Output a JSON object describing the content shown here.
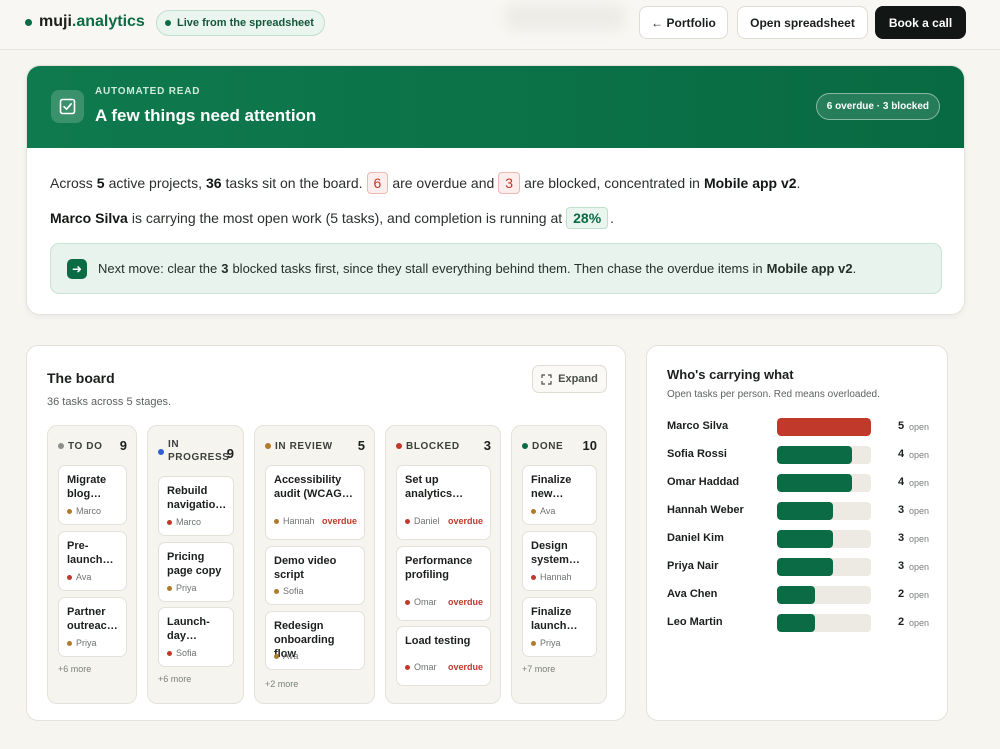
{
  "topbar": {
    "brand_a": "muji",
    "brand_b": ".analytics",
    "live_label": "Live from the spreadsheet",
    "portfolio_label": "← Portfolio",
    "spreadsheet_label": "Open spreadsheet",
    "book_label": "Book a call"
  },
  "hero": {
    "kicker": "AUTOMATED READ",
    "title": "A few things need attention",
    "badge": "6 overdue · 3 blocked",
    "l1_a": "Across",
    "l1_projects": "5",
    "l1_b": "active projects,",
    "l1_tasks": "36",
    "l1_c": "tasks sit on the board.",
    "l1_overdue": "6",
    "l1_d": "are overdue and",
    "l1_blocked": "3",
    "l1_e": "are blocked, concentrated in",
    "l1_project": "Mobile app v2",
    "l1_end": ".",
    "l2_name": "Marco Silva",
    "l2_a": "is carrying the most open work (5 tasks), and completion is running at",
    "l2_pct": "28%",
    "l2_end": ".",
    "next_a": "Next move: clear the",
    "next_n": "3",
    "next_b": "blocked tasks first, since they stall everything behind them. Then chase the overdue items in",
    "next_project": "Mobile app v2",
    "next_end": "."
  },
  "board": {
    "title": "The board",
    "subtitle": "36 tasks across 5 stages.",
    "expand_label": "Expand",
    "columns": [
      {
        "name": "TO DO",
        "count": "9",
        "color": "#8a8f8b",
        "more": "+6 more",
        "cards": [
          {
            "title": "Migrate blog…",
            "person": "Marco",
            "overdue": ""
          },
          {
            "title": "Pre-launch…",
            "person": "Ava",
            "overdue": ""
          },
          {
            "title": "Partner outreac…",
            "person": "Priya",
            "overdue": ""
          }
        ]
      },
      {
        "name": "IN PROGRESS",
        "name_1": "IN",
        "name_2": "PROGRESS",
        "count": "9",
        "color": "#2f5fd0",
        "more": "+6 more",
        "cards": [
          {
            "title": "Rebuild navigatio…",
            "person": "Marco",
            "overdue": ""
          },
          {
            "title": "Pricing page copy",
            "person": "Priya",
            "overdue": ""
          },
          {
            "title": "Launch-day…",
            "person": "Sofia",
            "overdue": ""
          }
        ]
      },
      {
        "name": "IN REVIEW",
        "count": "5",
        "color": "#b07a2a",
        "more": "+2 more",
        "cards": [
          {
            "title": "Accessibility audit (WCAG…",
            "person": "Hannah",
            "overdue": "overdue"
          },
          {
            "title": "Demo video script",
            "person": "Sofia",
            "overdue": ""
          },
          {
            "title": "Redesign onboarding flow",
            "person": "Ava",
            "overdue": ""
          }
        ]
      },
      {
        "name": "BLOCKED",
        "count": "3",
        "color": "#c0392b",
        "more": "",
        "cards": [
          {
            "title": "Set up analytics…",
            "person": "Daniel",
            "overdue": "overdue"
          },
          {
            "title": "Performance profiling",
            "person": "Omar",
            "overdue": "overdue"
          },
          {
            "title": "Load testing",
            "person": "Omar",
            "overdue": "overdue"
          }
        ]
      },
      {
        "name": "DONE",
        "count": "10",
        "color": "#0b6b45",
        "more": "+7 more",
        "cards": [
          {
            "title": "Finalize new…",
            "person": "Ava",
            "overdue": ""
          },
          {
            "title": "Design system…",
            "person": "Hannah",
            "overdue": ""
          },
          {
            "title": "Finalize launch…",
            "person": "Priya",
            "overdue": ""
          }
        ]
      }
    ]
  },
  "people": {
    "title": "Who's carrying what",
    "subtitle": "Open tasks per person. Red means overloaded.",
    "open_label": "open",
    "max": 5,
    "rows": [
      {
        "name": "Marco Silva",
        "count": 5,
        "overloaded": true
      },
      {
        "name": "Sofia Rossi",
        "count": 4,
        "overloaded": false
      },
      {
        "name": "Omar Haddad",
        "count": 4,
        "overloaded": false
      },
      {
        "name": "Hannah Weber",
        "count": 3,
        "overloaded": false
      },
      {
        "name": "Daniel Kim",
        "count": 3,
        "overloaded": false
      },
      {
        "name": "Priya Nair",
        "count": 3,
        "overloaded": false
      },
      {
        "name": "Ava Chen",
        "count": 2,
        "overloaded": false
      },
      {
        "name": "Leo Martin",
        "count": 2,
        "overloaded": false
      }
    ]
  },
  "colors": {
    "accent": "#0b6b45",
    "danger": "#c0392b",
    "background": "#f6f5f0"
  }
}
